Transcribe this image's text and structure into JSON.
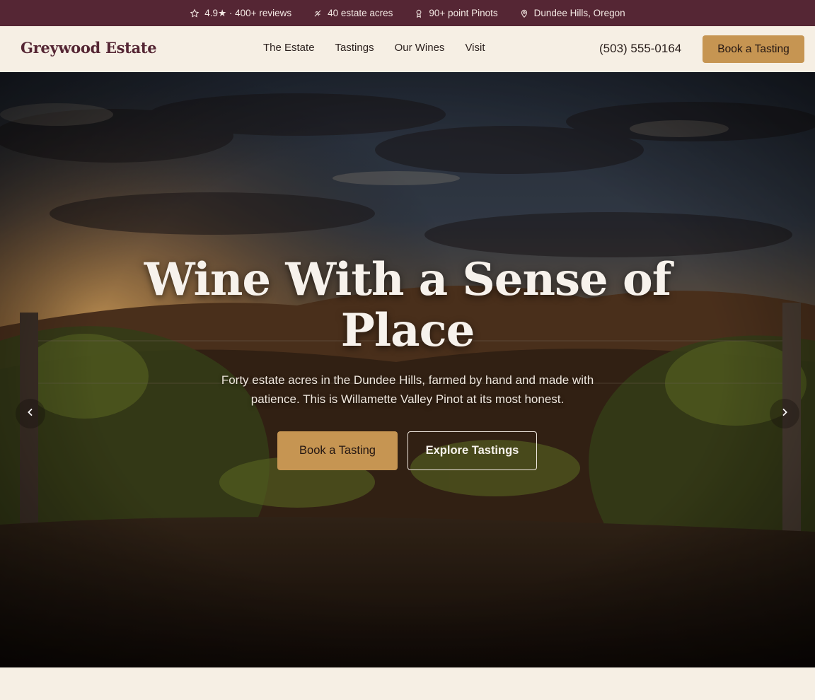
{
  "topbar": {
    "items": [
      {
        "icon": "star-icon",
        "text": "4.9★ · 400+ reviews"
      },
      {
        "icon": "vines-icon",
        "text": "40 estate acres"
      },
      {
        "icon": "award-icon",
        "text": "90+ point Pinots"
      },
      {
        "icon": "map-pin-icon",
        "text": "Dundee Hills, Oregon"
      }
    ]
  },
  "header": {
    "logo": "Greywood Estate",
    "nav": [
      "The Estate",
      "Tastings",
      "Our Wines",
      "Visit"
    ],
    "phone": "(503) 555-0164",
    "cta": "Book a Tasting"
  },
  "hero": {
    "title_line1": "Wine With a Sense of",
    "title_line2": "Place",
    "subtitle": "Forty estate acres in the Dundee Hills, farmed by hand and made with patience. This is Willamette Valley Pinot at its most honest.",
    "primary_button": "Book a Tasting",
    "secondary_button": "Explore Tastings",
    "prev_icon": "chevron-left-icon",
    "next_icon": "chevron-right-icon"
  },
  "colors": {
    "topbar_bg": "#552634",
    "brand": "#552634",
    "accent": "#c69552",
    "page_bg": "#f6efe4"
  }
}
